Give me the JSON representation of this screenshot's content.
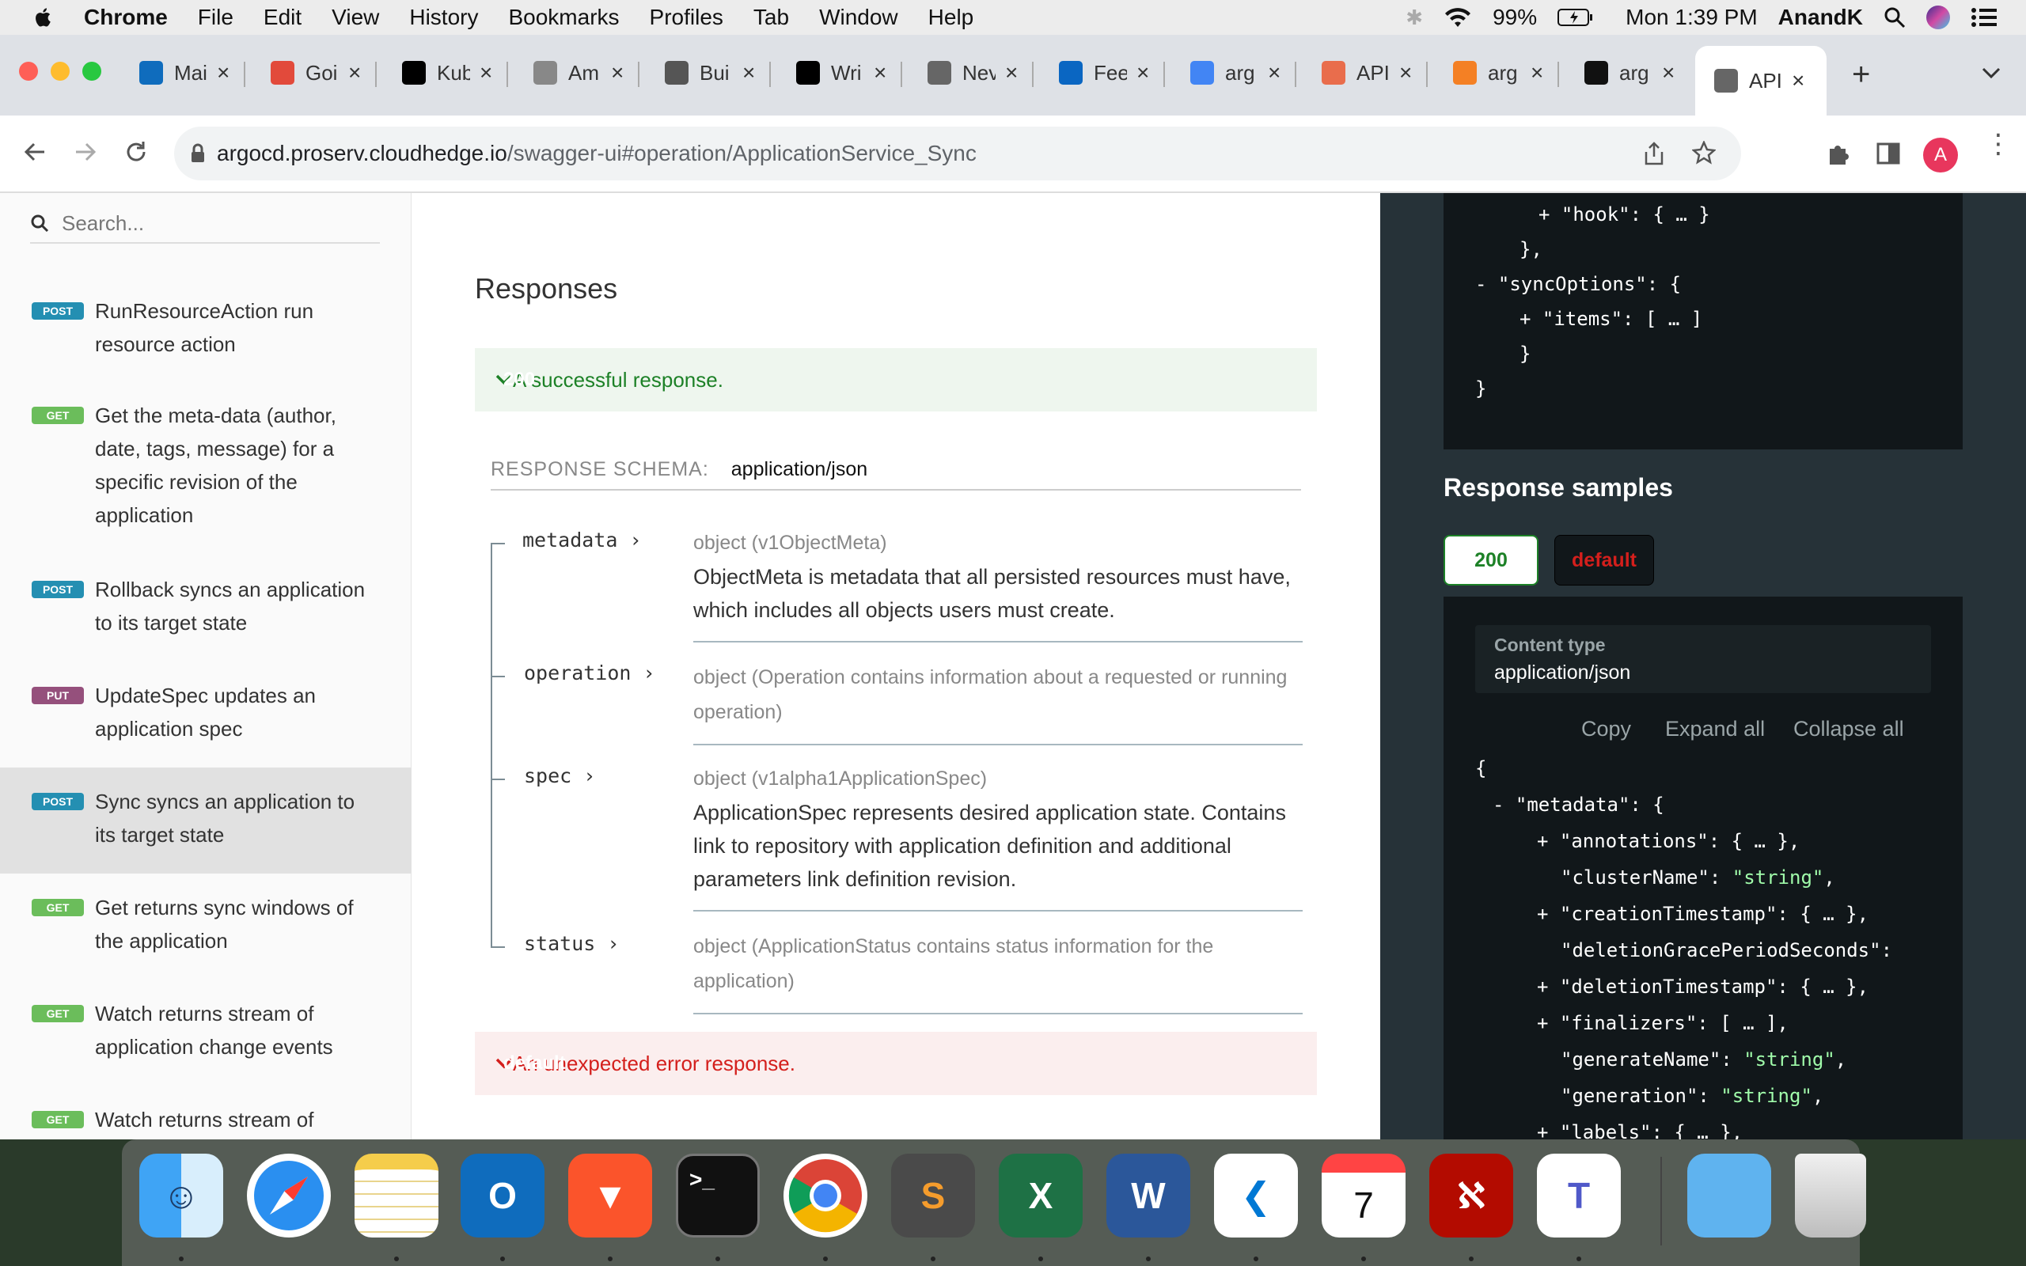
{
  "menubar": {
    "app": "Chrome",
    "items": [
      "File",
      "Edit",
      "View",
      "History",
      "Bookmarks",
      "Profiles",
      "Tab",
      "Window",
      "Help"
    ],
    "battery": "99%",
    "clock": "Mon 1:39 PM",
    "user": "AnandK"
  },
  "tabs": [
    {
      "title": "Mai",
      "icon": "outlook-icon",
      "color": "#0f6cbd"
    },
    {
      "title": "Goi",
      "icon": "bolt-icon",
      "color": "#e24a3b"
    },
    {
      "title": "Kub",
      "icon": "medium-icon",
      "color": "#000000"
    },
    {
      "title": "Am",
      "icon": "chart-icon",
      "color": "#888888"
    },
    {
      "title": "Bui",
      "icon": "briefcase-icon",
      "color": "#555555"
    },
    {
      "title": "Wri",
      "icon": "medium-icon",
      "color": "#000000"
    },
    {
      "title": "Nev",
      "icon": "chrome-icon",
      "color": "#666666"
    },
    {
      "title": "Fee",
      "icon": "linkedin-icon",
      "color": "#0a66c2"
    },
    {
      "title": "arg",
      "icon": "google-icon",
      "color": "#4285f4"
    },
    {
      "title": "API",
      "icon": "argo-icon",
      "color": "#e96d4c"
    },
    {
      "title": "arg",
      "icon": "stackoverflow-icon",
      "color": "#f48024"
    },
    {
      "title": "arg",
      "icon": "github-icon",
      "color": "#111111"
    },
    {
      "title": "API",
      "icon": "globe-icon",
      "color": "#666666",
      "active": true
    }
  ],
  "url": {
    "host": "argocd.proserv.cloudhedge.io",
    "path": "/swagger-ui#operation/ApplicationService_Sync"
  },
  "profile_initial": "A",
  "sidebar": {
    "search_placeholder": "Search...",
    "items": [
      {
        "method": "POST",
        "label": "RunResourceAction run resource action"
      },
      {
        "method": "GET",
        "label": "Get the meta-data (author, date, tags, message) for a specific revision of the application"
      },
      {
        "method": "POST",
        "label": "Rollback syncs an application to its target state"
      },
      {
        "method": "PUT",
        "label": "UpdateSpec updates an application spec"
      },
      {
        "method": "POST",
        "label": "Sync syncs an application to its target state",
        "selected": true
      },
      {
        "method": "GET",
        "label": "Get returns sync windows of the application"
      },
      {
        "method": "GET",
        "label": "Watch returns stream of application change events"
      },
      {
        "method": "GET",
        "label": "Watch returns stream of application resource tree"
      }
    ]
  },
  "responses": {
    "heading": "Responses",
    "ok": {
      "code": "200",
      "text": "A successful response."
    },
    "error": {
      "code": "default",
      "text": "An unexpected error response."
    },
    "schema_label": "RESPONSE SCHEMA:",
    "schema_value": "application/json",
    "properties": [
      {
        "name": "metadata",
        "type": "object (v1ObjectMeta)",
        "desc": "ObjectMeta is metadata that all persisted resources must have, which includes all objects users must create."
      },
      {
        "name": "operation",
        "type": "object (Operation contains information about a requested or running operation)",
        "desc": ""
      },
      {
        "name": "spec",
        "type": "object (v1alpha1ApplicationSpec)",
        "desc": "ApplicationSpec represents desired application state. Contains link to repository with application definition and additional parameters link definition revision."
      },
      {
        "name": "status",
        "type": "object (ApplicationStatus contains status information for the application)",
        "desc": ""
      }
    ]
  },
  "right_panel": {
    "samples_heading": "Response samples",
    "tab_200": "200",
    "tab_default": "default",
    "content_type_label": "Content type",
    "content_type_value": "application/json",
    "actions": [
      "Copy",
      "Expand all",
      "Collapse all"
    ]
  }
}
